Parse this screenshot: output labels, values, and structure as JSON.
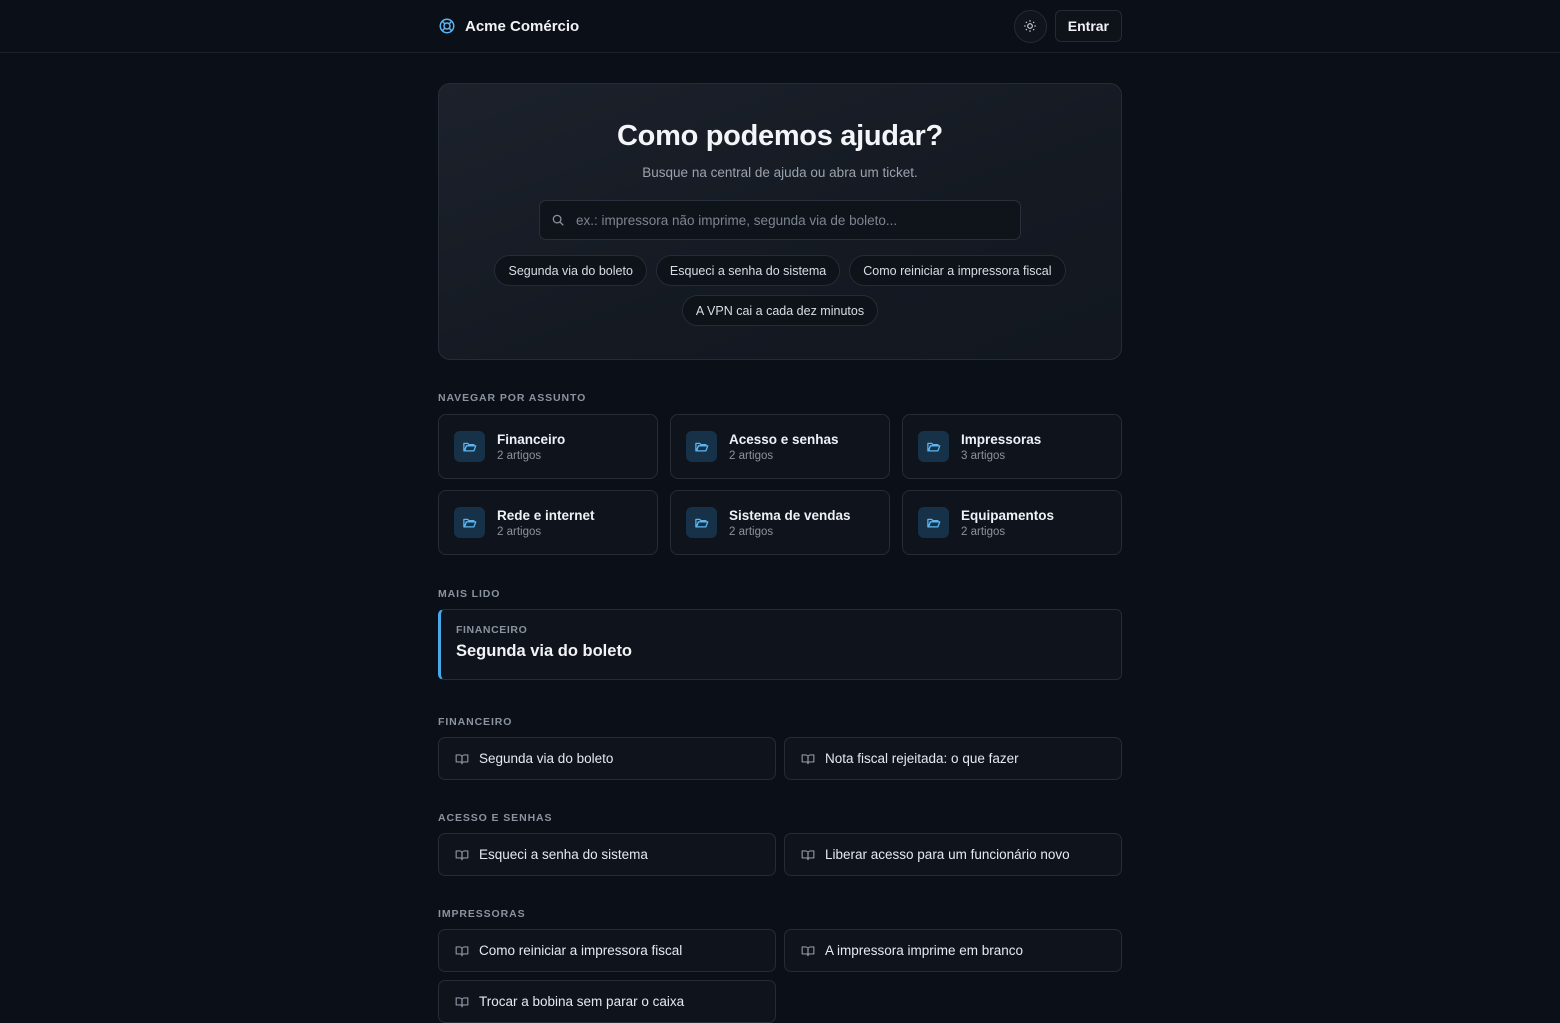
{
  "header": {
    "brand": "Acme Comércio",
    "login_label": "Entrar"
  },
  "hero": {
    "title": "Como podemos ajudar?",
    "subtitle": "Busque na central de ajuda ou abra um ticket.",
    "search_placeholder": "ex.: impressora não imprime, segunda via de boleto...",
    "chips": [
      "Segunda via do boleto",
      "Esqueci a senha do sistema",
      "Como reiniciar a impressora fiscal",
      "A VPN cai a cada dez minutos"
    ]
  },
  "topics": {
    "label": "NAVEGAR POR ASSUNTO",
    "items": [
      {
        "title": "Financeiro",
        "count": "2 artigos"
      },
      {
        "title": "Acesso e senhas",
        "count": "2 artigos"
      },
      {
        "title": "Impressoras",
        "count": "3 artigos"
      },
      {
        "title": "Rede e internet",
        "count": "2 artigos"
      },
      {
        "title": "Sistema de vendas",
        "count": "2 artigos"
      },
      {
        "title": "Equipamentos",
        "count": "2 artigos"
      }
    ]
  },
  "popular": {
    "label": "MAIS LIDO",
    "category": "FINANCEIRO",
    "title": "Segunda via do boleto"
  },
  "groups": [
    {
      "label": "FINANCEIRO",
      "articles": [
        "Segunda via do boleto",
        "Nota fiscal rejeitada: o que fazer"
      ]
    },
    {
      "label": "ACESSO E SENHAS",
      "articles": [
        "Esqueci a senha do sistema",
        "Liberar acesso para um funcionário novo"
      ]
    },
    {
      "label": "IMPRESSORAS",
      "articles": [
        "Como reiniciar a impressora fiscal",
        "A impressora imprime em branco",
        "Trocar a bobina sem parar o caixa"
      ]
    }
  ],
  "colors": {
    "accent": "#4aa8e8",
    "background": "#0b0f17"
  },
  "icons": {
    "brand": "lifebuoy-icon",
    "theme": "sun-icon",
    "search": "search-icon",
    "topic": "folder-open-icon",
    "article": "book-open-icon"
  }
}
